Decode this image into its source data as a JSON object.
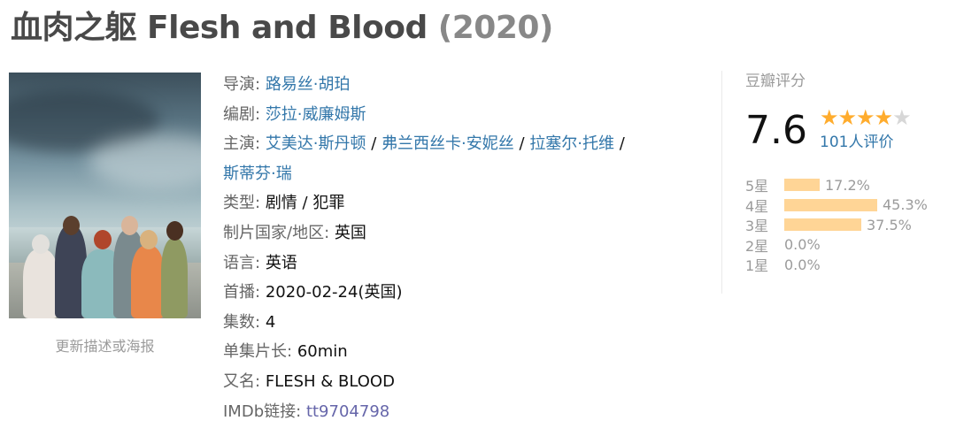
{
  "title": {
    "main": "血肉之躯 Flesh and Blood",
    "year": "(2020)"
  },
  "poster": {
    "caption": "更新描述或海报"
  },
  "info": {
    "director": {
      "label": "导演:",
      "name": "路易丝·胡珀"
    },
    "writer": {
      "label": "编剧:",
      "name": "莎拉·威廉姆斯"
    },
    "cast": {
      "label": "主演:",
      "names": [
        "艾美达·斯丹顿",
        "弗兰西丝卡·安妮丝",
        "拉塞尔·托维",
        "斯蒂芬·瑞"
      ],
      "sep": " / "
    },
    "genre": {
      "label": "类型:",
      "value": "剧情 / 犯罪"
    },
    "country": {
      "label": "制片国家/地区:",
      "value": "英国"
    },
    "language": {
      "label": "语言:",
      "value": "英语"
    },
    "premiere": {
      "label": "首播:",
      "value": "2020-02-24(英国)"
    },
    "episodes": {
      "label": "集数:",
      "value": "4"
    },
    "runtime": {
      "label": "单集片长:",
      "value": "60min"
    },
    "aka": {
      "label": "又名:",
      "value": "FLESH & BLOOD"
    },
    "imdb": {
      "label": "IMDb链接:",
      "value": "tt9704798"
    }
  },
  "rating": {
    "title": "豆瓣评分",
    "score": "7.6",
    "stars_filled": 4,
    "stars_total": 5,
    "count": "101人评价",
    "bar_color": "#ffd596",
    "star_color": "#ffac2d",
    "distribution": [
      {
        "label": "5星",
        "percent": "17.2%",
        "value": 17.2
      },
      {
        "label": "4星",
        "percent": "45.3%",
        "value": 45.3
      },
      {
        "label": "3星",
        "percent": "37.5%",
        "value": 37.5
      },
      {
        "label": "2星",
        "percent": "0.0%",
        "value": 0.0
      },
      {
        "label": "1星",
        "percent": "0.0%",
        "value": 0.0
      }
    ]
  }
}
